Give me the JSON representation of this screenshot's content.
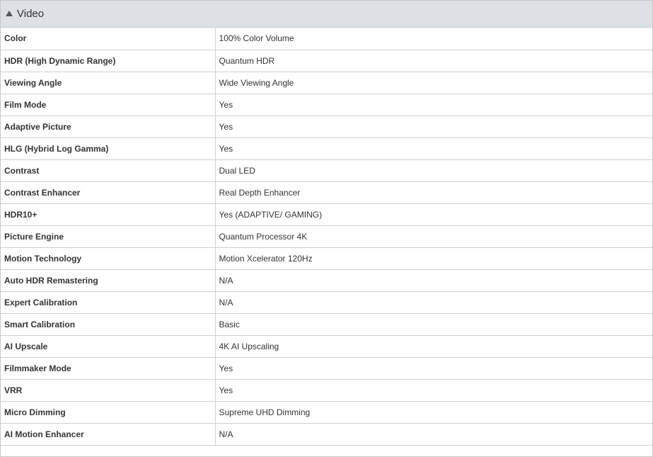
{
  "section": {
    "title": "Video",
    "toggle_icon": "triangle-up-icon"
  },
  "rows": [
    {
      "label": "Color",
      "value": "100% Color Volume"
    },
    {
      "label": "HDR (High Dynamic Range)",
      "value": "Quantum HDR"
    },
    {
      "label": "Viewing Angle",
      "value": "Wide Viewing Angle"
    },
    {
      "label": "Film Mode",
      "value": "Yes"
    },
    {
      "label": "Adaptive Picture",
      "value": "Yes"
    },
    {
      "label": "HLG (Hybrid Log Gamma)",
      "value": "Yes"
    },
    {
      "label": "Contrast",
      "value": "Dual LED"
    },
    {
      "label": "Contrast Enhancer",
      "value": "Real Depth Enhancer"
    },
    {
      "label": "HDR10+",
      "value": "Yes (ADAPTIVE/ GAMING)"
    },
    {
      "label": "Picture Engine",
      "value": "Quantum Processor 4K"
    },
    {
      "label": "Motion Technology",
      "value": "Motion Xcelerator 120Hz"
    },
    {
      "label": "Auto HDR Remastering",
      "value": "N/A"
    },
    {
      "label": "Expert Calibration",
      "value": "N/A"
    },
    {
      "label": "Smart Calibration",
      "value": "Basic"
    },
    {
      "label": "AI Upscale",
      "value": "4K AI Upscaling"
    },
    {
      "label": "Filmmaker Mode",
      "value": "Yes"
    },
    {
      "label": "VRR",
      "value": "Yes"
    },
    {
      "label": "Micro Dimming",
      "value": "Supreme UHD Dimming"
    },
    {
      "label": "AI Motion Enhancer",
      "value": "N/A"
    }
  ],
  "colors": {
    "header_bg": "#dde1e6",
    "border": "#cfcfcf",
    "text": "#333333"
  }
}
